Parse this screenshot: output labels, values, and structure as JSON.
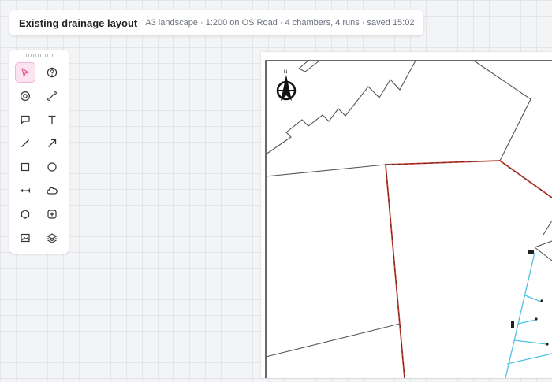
{
  "header": {
    "title": "Existing drainage layout",
    "meta": "A3 landscape · 1:200 on OS Road · 4 chambers, 4 runs · saved 15:02"
  },
  "toolbar": {
    "tools": [
      {
        "name": "select",
        "icon": "pointer-icon",
        "active": true
      },
      {
        "name": "help",
        "icon": "help-icon"
      },
      {
        "name": "manhole",
        "icon": "target-icon"
      },
      {
        "name": "pipe",
        "icon": "pipe-icon"
      },
      {
        "name": "comment",
        "icon": "comment-icon"
      },
      {
        "name": "text",
        "icon": "text-icon"
      },
      {
        "name": "line",
        "icon": "line-icon"
      },
      {
        "name": "arrow",
        "icon": "arrow-icon"
      },
      {
        "name": "rectangle",
        "icon": "rectangle-icon"
      },
      {
        "name": "circle",
        "icon": "circle-icon"
      },
      {
        "name": "dimension",
        "icon": "dimension-icon"
      },
      {
        "name": "cloud",
        "icon": "cloud-icon"
      },
      {
        "name": "polygon",
        "icon": "hexagon-icon"
      },
      {
        "name": "add-symbol",
        "icon": "plus-box-icon"
      },
      {
        "name": "image",
        "icon": "image-icon"
      },
      {
        "name": "layers",
        "icon": "layers-icon"
      }
    ],
    "accent": "#e75ea2"
  },
  "drawing": {
    "north_label": "N",
    "boundary_color": "#c0392b",
    "drain_color": "#4fc3e0",
    "line_color": "#555555"
  }
}
